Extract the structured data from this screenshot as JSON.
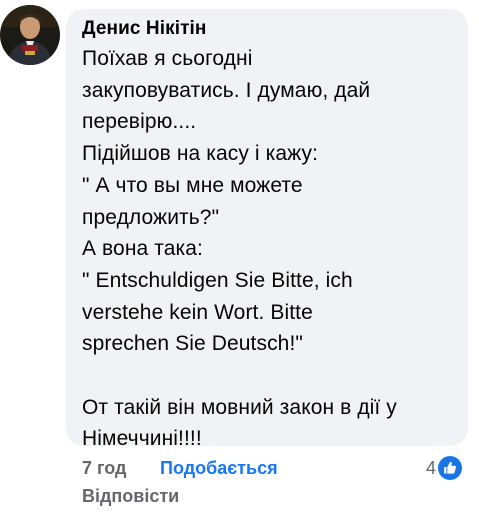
{
  "comment": {
    "author": "Денис Нікітін",
    "text": "Поїхав я сьогодні\nзакуповуватись. І думаю, дай\nперевірю....\nПідійшов на касу і кажу:\n\" А что вы мне можете\nпредложить?\"\nА вона така:\n\" Entschuldigen Sie Bitte,  ich\nverstehe kein Wort. Bitte\nsprechen Sie Deutsch!\"\n\nОт такій він мовний закон в дії у\nНімеччині!!!!",
    "time": "7 год",
    "like_label": "Подобається",
    "reply_label": "Відповісти",
    "reaction_count": "4",
    "reaction_icon": "like-icon",
    "colors": {
      "bubble": "#f0f2f5",
      "link": "#1877f2",
      "meta": "#65676b",
      "text": "#050505"
    }
  }
}
